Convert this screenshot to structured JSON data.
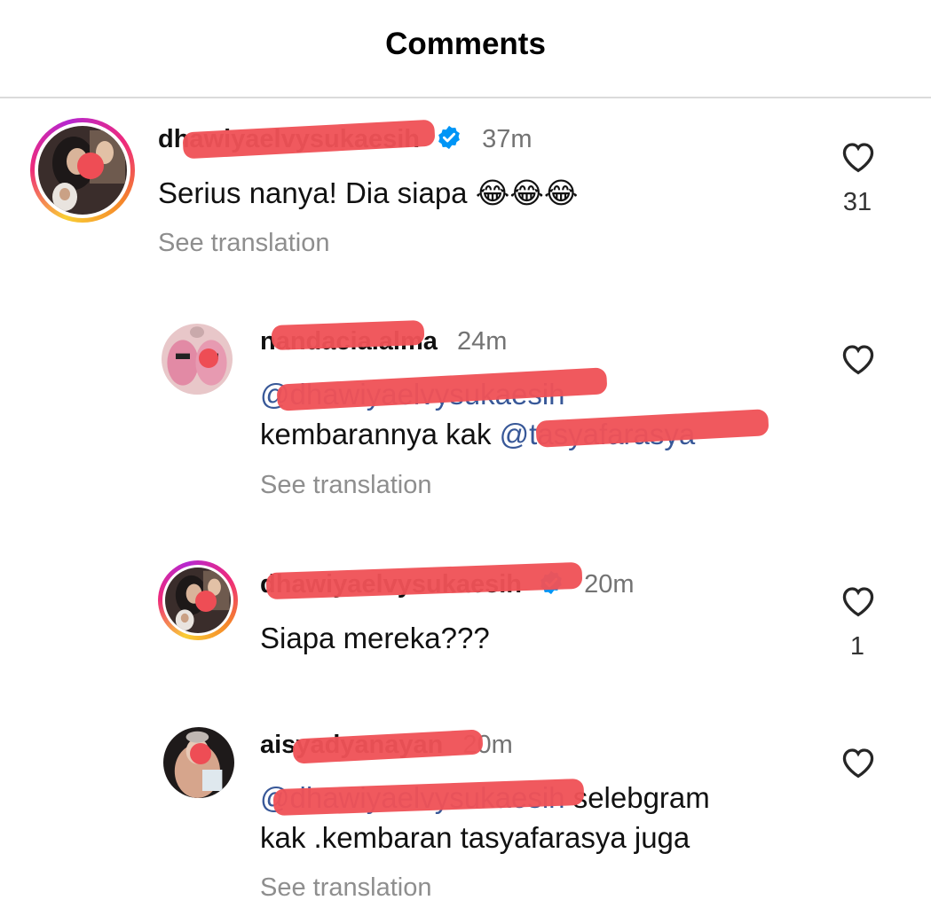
{
  "header": {
    "title": "Comments"
  },
  "comments": [
    {
      "username": "dhawiyaelvysukaesih",
      "time": "37m",
      "verified": true,
      "text": "Serius nanya! Dia siapa 😂😂😂",
      "see_translation": "See translation",
      "like_count": "31"
    },
    {
      "username": "nandacia.alma",
      "time": "24m",
      "verified": false,
      "mention": "@dhawiyaelvysukaesih",
      "text": "kembarannya kak",
      "mention2": "@tasyafarasya",
      "see_translation": "See translation",
      "like_count": ""
    },
    {
      "username": "dhawiyaelvysukaesih",
      "time": "20m",
      "verified": true,
      "text": "Siapa mereka???",
      "like_count": "1"
    },
    {
      "username": "aisyadyanayan",
      "time": "20m",
      "verified": false,
      "mention": "@dhawiyaelvysukaesih",
      "text_after": "selebgram",
      "text_line2": "kak .kembaran tasyafarasya juga",
      "see_translation": "See translation",
      "like_count": ""
    }
  ],
  "colors": {
    "mention": "#385898",
    "redaction": "#ef5257",
    "verified": "#0095f6",
    "muted": "#8e8e8e"
  },
  "icons": {
    "like": "heart-outline-icon",
    "verified": "verified-badge-icon"
  }
}
